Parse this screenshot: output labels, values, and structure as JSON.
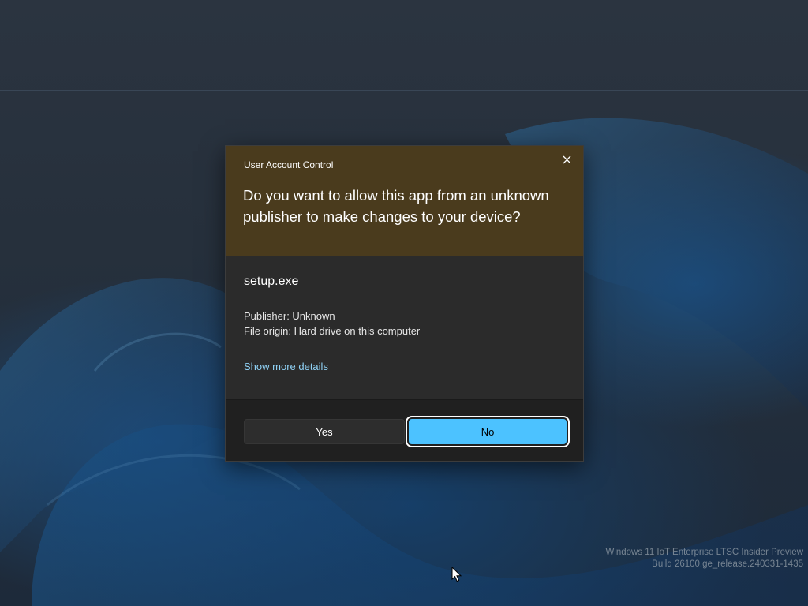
{
  "dialog": {
    "caption": "User Account Control",
    "question": "Do you want to allow this app from an unknown publisher to make changes to your device?",
    "app_name": "setup.exe",
    "publisher": "Publisher: Unknown",
    "file_origin": "File origin: Hard drive on this computer",
    "more_details": "Show more details",
    "yes_label": "Yes",
    "no_label": "No",
    "close_icon": "close-icon"
  },
  "watermark": {
    "line1": "Windows 11 IoT Enterprise LTSC Insider Preview",
    "line2": "Build 26100.ge_release.240331-1435"
  },
  "colors": {
    "header": "#4a3b1d",
    "body": "#2b2b2b",
    "footer": "#202020",
    "accent": "#4cc2ff",
    "link": "#8fd1f5"
  }
}
